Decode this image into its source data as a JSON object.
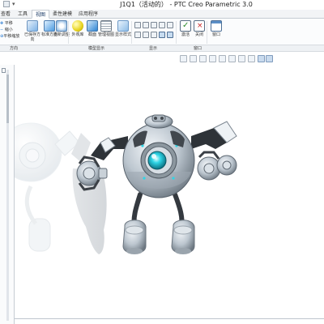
{
  "window": {
    "title": "J1Q1（活动的） - PTC Creo Parametric 3.0",
    "quick_access_arrow": "▾"
  },
  "tabs": [
    {
      "label": "查看",
      "active": false
    },
    {
      "label": "工具",
      "active": false
    },
    {
      "label": "视图",
      "active": true
    },
    {
      "label": "柔性建模",
      "active": false
    },
    {
      "label": "应用程序",
      "active": false
    }
  ],
  "ribbon": {
    "left_items": [
      "平移",
      "缩小",
      "平移缩放"
    ],
    "buttons": [
      {
        "label": "已保存方向",
        "icon": "saved-orientation-icon"
      },
      {
        "label": "标准方向",
        "icon": "standard-orientation-icon"
      },
      {
        "label": "重新调整",
        "icon": "refit-icon"
      },
      {
        "label": "外观库",
        "icon": "appearance-gallery-icon"
      },
      {
        "label": "截面",
        "icon": "section-icon"
      },
      {
        "label": "管理视图",
        "icon": "manage-views-icon"
      },
      {
        "label": "显示样式",
        "icon": "display-style-icon"
      },
      {
        "label": "激活",
        "icon": "activate-icon"
      },
      {
        "label": "关闭",
        "icon": "close-icon"
      },
      {
        "label": "窗口",
        "icon": "windows-icon"
      }
    ],
    "groups": [
      "方向",
      "模型显示",
      "显示",
      "窗口"
    ]
  },
  "colors": {
    "accent": "#1f6fc7",
    "ribbon_bg": "#fbfcfd",
    "robot_body": "#bcc6cf",
    "robot_dark": "#34393f",
    "robot_eye": "#2fd5e6"
  }
}
